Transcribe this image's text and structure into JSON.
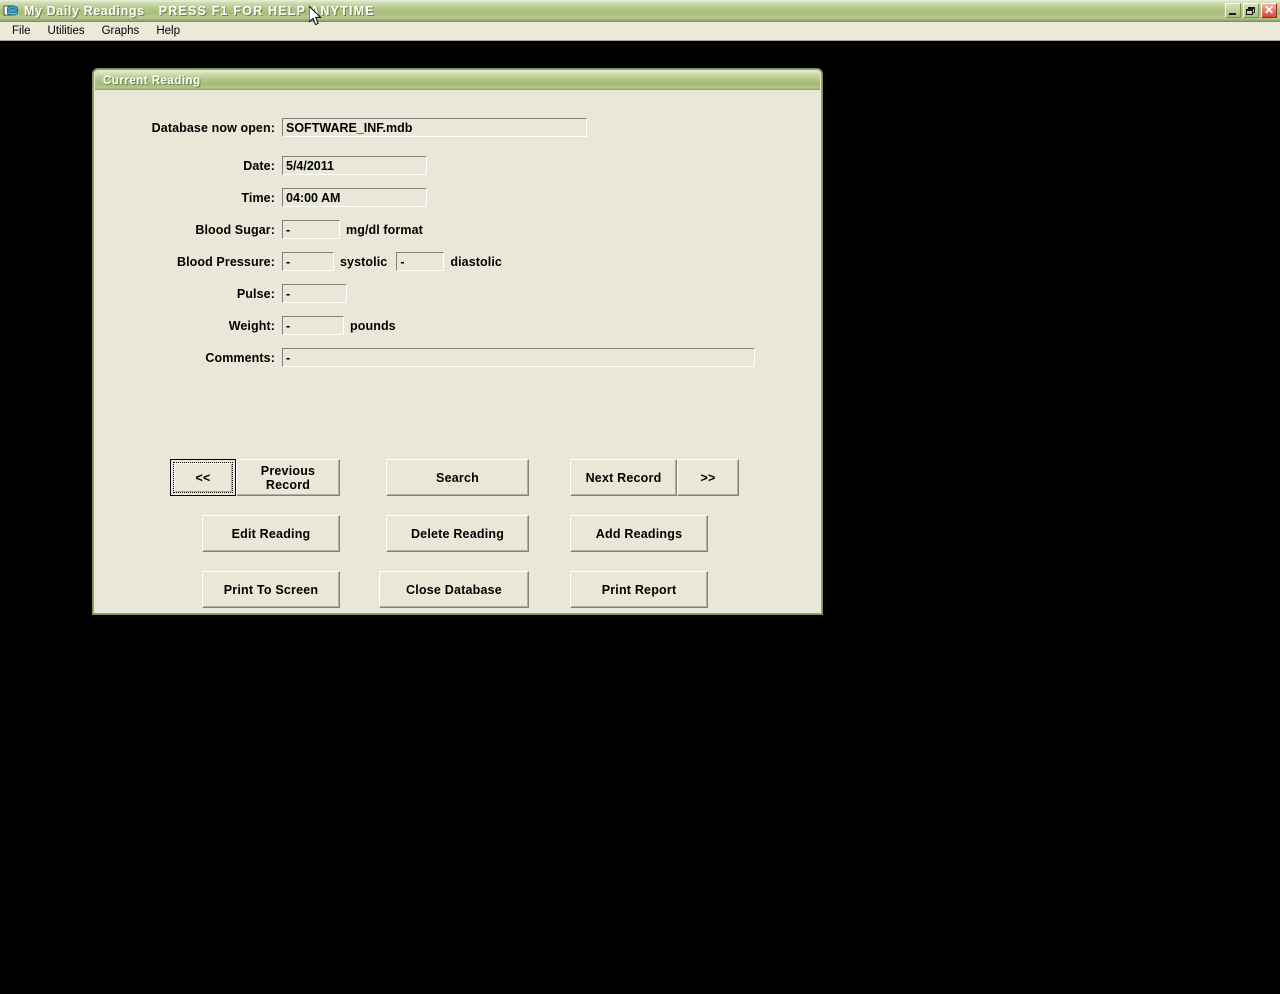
{
  "window": {
    "title": "My Daily Readings",
    "help_banner": "PRESS F1 FOR HELP ANYTIME",
    "icon": "database-window-icon",
    "controls": {
      "minimize_label": "minimize-icon",
      "restore_label": "restore-icon",
      "close_label": "✕"
    }
  },
  "menubar": {
    "items": [
      {
        "label": "File"
      },
      {
        "label": "Utilities"
      },
      {
        "label": "Graphs"
      },
      {
        "label": "Help"
      }
    ]
  },
  "dialog": {
    "title": "Current Reading",
    "fields": {
      "database": {
        "label": "Database now open:",
        "value": "SOFTWARE_INF.mdb"
      },
      "date": {
        "label": "Date:",
        "value": "5/4/2011"
      },
      "time": {
        "label": "Time:",
        "value": "04:00 AM"
      },
      "blood_sugar": {
        "label": "Blood Sugar:",
        "value": "-",
        "unit": "mg/dl format"
      },
      "blood_pressure": {
        "label": "Blood Pressure:",
        "systolic_value": "-",
        "systolic_unit": "systolic",
        "diastolic_value": "-",
        "diastolic_unit": "diastolic"
      },
      "pulse": {
        "label": "Pulse:",
        "value": "-"
      },
      "weight": {
        "label": "Weight:",
        "value": "-",
        "unit": "pounds"
      },
      "comments": {
        "label": "Comments:",
        "value": "-"
      }
    },
    "buttons": {
      "prev_arrow": "<<",
      "previous_record": "Previous\nRecord",
      "previous_record_line1": "Previous",
      "previous_record_line2": "Record",
      "search": "Search",
      "next_record": "Next Record",
      "next_arrow": ">>",
      "edit_reading": "Edit Reading",
      "delete_reading": "Delete Reading",
      "add_readings": "Add Readings",
      "print_to_screen": "Print To Screen",
      "close_database": "Close Database",
      "print_report": "Print Report"
    }
  },
  "colors": {
    "titlebar_green": "#a6bc7c",
    "dialog_face": "#e9e7d8",
    "menubar_face": "#ece9d8",
    "desktop_black": "#000000",
    "close_button_red": "#d4453a"
  }
}
